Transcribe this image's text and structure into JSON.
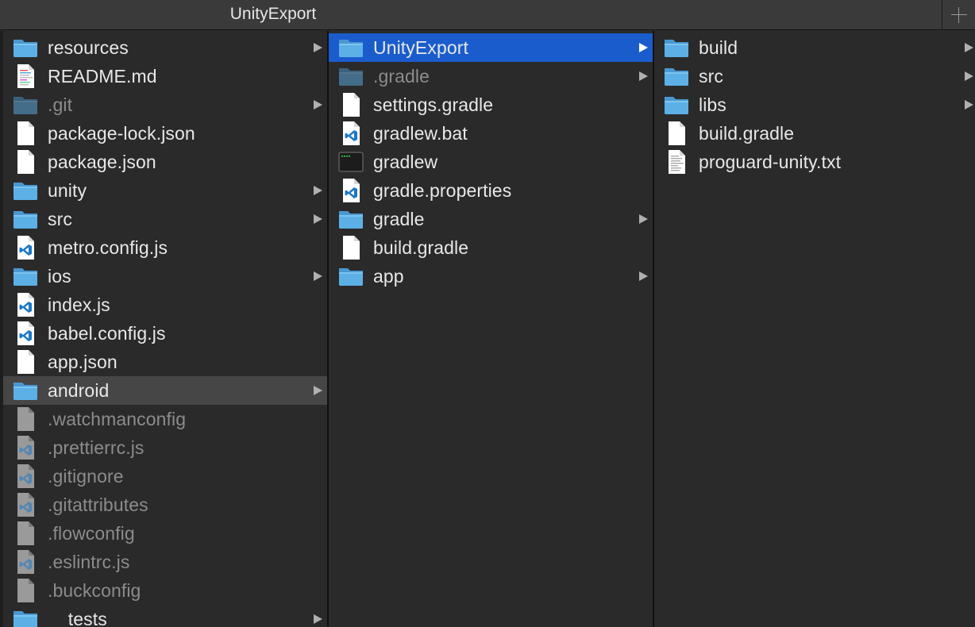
{
  "window": {
    "title": "UnityExport"
  },
  "columns": [
    {
      "items": [
        {
          "label": "resources",
          "type": "folder",
          "arrow": true
        },
        {
          "label": "README.md",
          "type": "markdown"
        },
        {
          "label": ".git",
          "type": "folder",
          "arrow": true,
          "dim": true
        },
        {
          "label": "package-lock.json",
          "type": "file"
        },
        {
          "label": "package.json",
          "type": "file"
        },
        {
          "label": "unity",
          "type": "folder",
          "arrow": true
        },
        {
          "label": "src",
          "type": "folder",
          "arrow": true
        },
        {
          "label": "metro.config.js",
          "type": "vscode"
        },
        {
          "label": "ios",
          "type": "folder",
          "arrow": true
        },
        {
          "label": "index.js",
          "type": "vscode"
        },
        {
          "label": "babel.config.js",
          "type": "vscode"
        },
        {
          "label": "app.json",
          "type": "file"
        },
        {
          "label": "android",
          "type": "folder",
          "arrow": true,
          "state": "highlight"
        },
        {
          "label": ".watchmanconfig",
          "type": "file",
          "dim": true
        },
        {
          "label": ".prettierrc.js",
          "type": "vscode",
          "dim": true
        },
        {
          "label": ".gitignore",
          "type": "vscode",
          "dim": true
        },
        {
          "label": ".gitattributes",
          "type": "vscode",
          "dim": true
        },
        {
          "label": ".flowconfig",
          "type": "file",
          "dim": true
        },
        {
          "label": ".eslintrc.js",
          "type": "vscode",
          "dim": true
        },
        {
          "label": ".buckconfig",
          "type": "file",
          "dim": true
        },
        {
          "label": "__tests__",
          "type": "folder",
          "arrow": true
        }
      ]
    },
    {
      "items": [
        {
          "label": "UnityExport",
          "type": "folder",
          "arrow": true,
          "state": "selected"
        },
        {
          "label": ".gradle",
          "type": "folder",
          "arrow": true,
          "dim": true
        },
        {
          "label": "settings.gradle",
          "type": "file"
        },
        {
          "label": "gradlew.bat",
          "type": "vscode"
        },
        {
          "label": "gradlew",
          "type": "terminal"
        },
        {
          "label": "gradle.properties",
          "type": "vscode"
        },
        {
          "label": "gradle",
          "type": "folder",
          "arrow": true
        },
        {
          "label": "build.gradle",
          "type": "file"
        },
        {
          "label": "app",
          "type": "folder",
          "arrow": true
        }
      ]
    },
    {
      "items": [
        {
          "label": "build",
          "type": "folder",
          "arrow": true
        },
        {
          "label": "src",
          "type": "folder",
          "arrow": true
        },
        {
          "label": "libs",
          "type": "folder",
          "arrow": true
        },
        {
          "label": "build.gradle",
          "type": "file"
        },
        {
          "label": "proguard-unity.txt",
          "type": "text"
        }
      ]
    }
  ],
  "icons": {
    "folder": "folder-icon",
    "markdown": "markdown-file-icon",
    "file": "document-icon",
    "vscode": "vscode-file-icon",
    "terminal": "terminal-exec-icon",
    "text": "text-file-icon"
  },
  "colors": {
    "selected": "#1a5ccc",
    "highlight": "#464646",
    "folder": "#5cb0e6"
  }
}
